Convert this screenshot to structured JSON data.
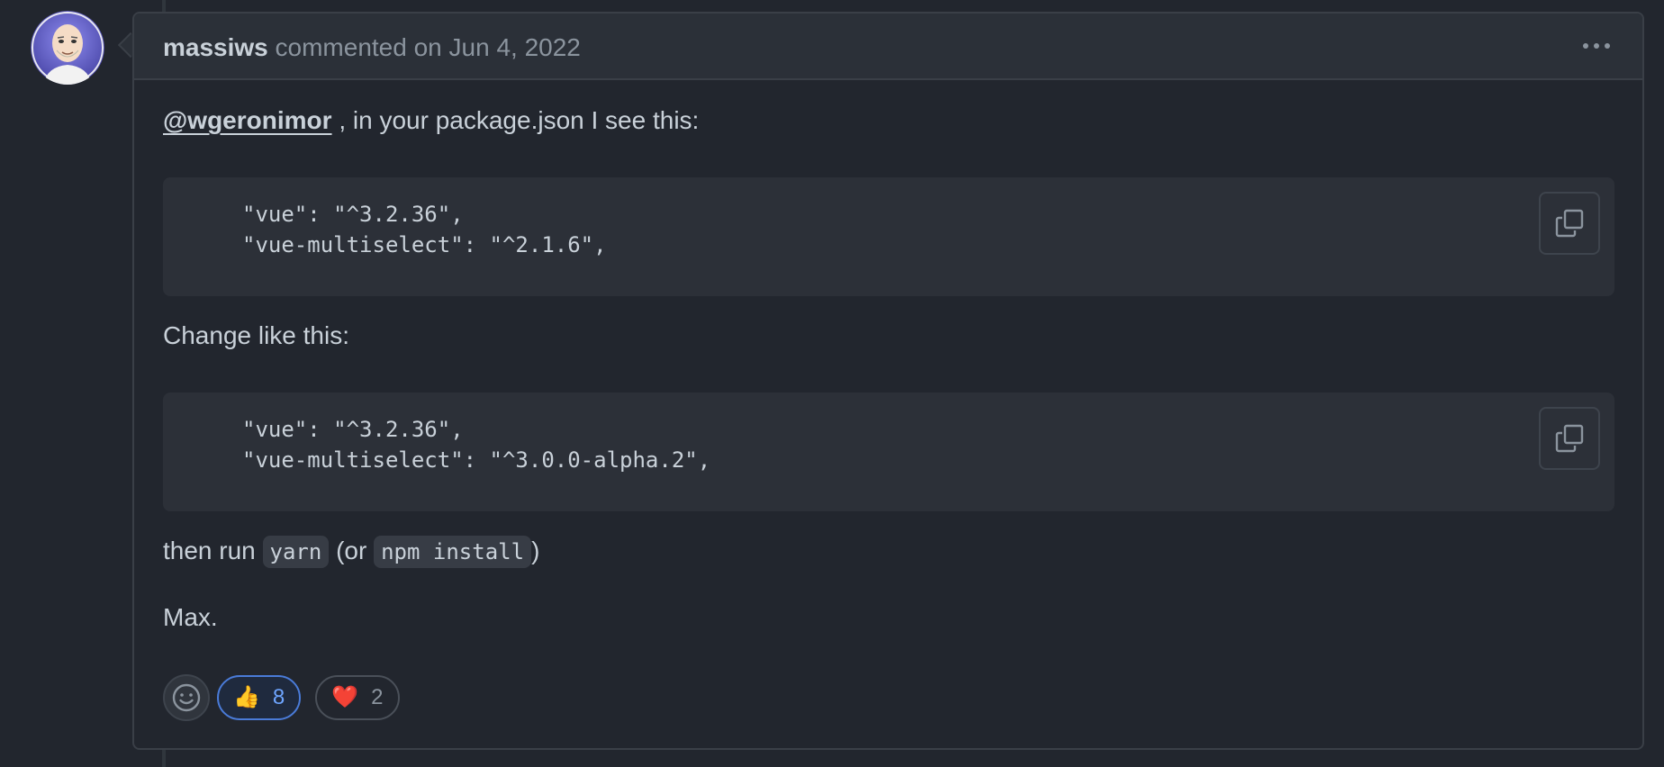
{
  "comment": {
    "author": "massiws",
    "meta": "commented on Jun 4, 2022",
    "body": {
      "mention": "@wgeronimor",
      "intro_rest": " , in your package.json I see this:",
      "code_block_1": [
        "\"vue\": \"^3.2.36\",",
        "\"vue-multiselect\": \"^2.1.6\","
      ],
      "change_text": "Change like this:",
      "code_block_2": [
        "\"vue\": \"^3.2.36\",",
        "\"vue-multiselect\": \"^3.0.0-alpha.2\","
      ],
      "run_prefix": "then run ",
      "run_code_1": "yarn",
      "run_mid": " (or ",
      "run_code_2": "npm install",
      "run_suffix": ")",
      "signoff": "Max."
    },
    "reactions": [
      {
        "emoji": "👍",
        "icon": "thumbs-up-icon",
        "count": "8",
        "active": true
      },
      {
        "emoji": "❤️",
        "icon": "heart-icon",
        "count": "2",
        "active": false
      }
    ]
  },
  "colors": {
    "background": "#22262e",
    "header": "#2b3038",
    "accent": "#4a7bd8",
    "text": "#c9d1d9",
    "muted": "#8b949e"
  }
}
